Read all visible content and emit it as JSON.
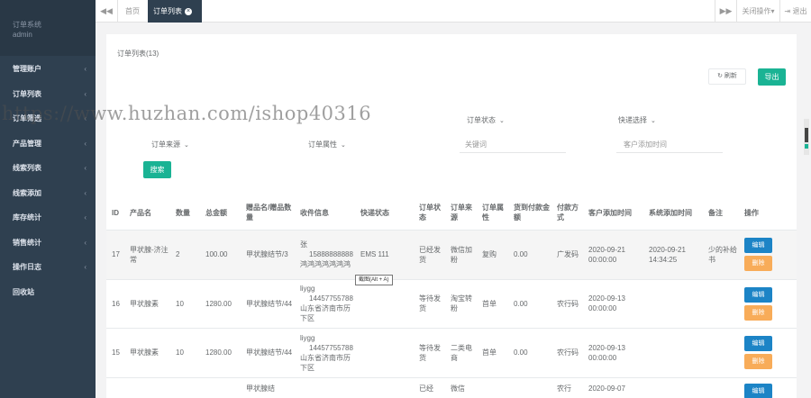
{
  "sidebar": {
    "app_name": "订单系统",
    "user": "admin",
    "items": [
      {
        "label": "管理账户"
      },
      {
        "label": "订单列表"
      },
      {
        "label": "订单筛选"
      },
      {
        "label": "产品管理"
      },
      {
        "label": "线索列表"
      },
      {
        "label": "线索添加"
      },
      {
        "label": "库存统计"
      },
      {
        "label": "销售统计"
      },
      {
        "label": "操作日志"
      },
      {
        "label": "回收站"
      }
    ],
    "chevron": "‹"
  },
  "topbar": {
    "back_icon": "◀◀",
    "home_tab": "首页",
    "active_tab": "订单列表",
    "close_tab_icon": "×",
    "forward_icon": "▶▶",
    "close_ops": "关闭操作▾",
    "logout": "⇥ 退出"
  },
  "panel": {
    "title": "订单列表(13)",
    "refresh": "↻ 刷新",
    "export": "导出"
  },
  "filters": {
    "row1": [
      {
        "label": "订单状态",
        "type": "select"
      },
      {
        "label": "快递选择",
        "type": "select"
      }
    ],
    "row2": [
      {
        "label": "订单来源",
        "type": "select"
      },
      {
        "label": "订单属性",
        "type": "select"
      },
      {
        "label": "关键词",
        "type": "input"
      },
      {
        "label": "客户添加时间",
        "type": "input"
      }
    ],
    "chevron": "⌄",
    "search": "搜索"
  },
  "table": {
    "headers": [
      "ID",
      "产品名",
      "数量",
      "总金额",
      "赠品名/赠品数量",
      "收件信息",
      "快递状态",
      "订单状态",
      "订单来源",
      "订单属性",
      "货到付款金额",
      "付款方式",
      "客户添加时间",
      "系统添加时间",
      "备注",
      "操作"
    ],
    "rows": [
      {
        "id": "17",
        "product": "甲状腺-济注常",
        "qty": "2",
        "total": "100.00",
        "gift": "甲状腺结节/3",
        "receiver_name": "张",
        "receiver_phone": "15888888888",
        "receiver_addr": "鸿鸿鸿鸿鸿鸿鸿",
        "express": "EMS 111",
        "status": "已经发货",
        "source": "微信加粉",
        "attr": "复购",
        "cod": "0.00",
        "pay": "广发码",
        "cust_time": "2020-09-21 00:00:00",
        "sys_time": "2020-09-21 14:34:25",
        "note": "少的补给书"
      },
      {
        "id": "16",
        "product": "甲状腺素",
        "qty": "10",
        "total": "1280.00",
        "gift": "甲状腺结节/44",
        "receiver_name": "liygg",
        "receiver_phone": "14457755788",
        "receiver_addr": "山东省济南市历下区",
        "express": "",
        "status": "等待发货",
        "source": "淘宝转粉",
        "attr": "首单",
        "cod": "0.00",
        "pay": "农行码",
        "cust_time": "2020-09-13 00:00:00",
        "sys_time": "",
        "note": ""
      },
      {
        "id": "15",
        "product": "甲状腺素",
        "qty": "10",
        "total": "1280.00",
        "gift": "甲状腺结节/44",
        "receiver_name": "liygg",
        "receiver_phone": "14457755788",
        "receiver_addr": "山东省济南市历下区",
        "express": "",
        "status": "等待发货",
        "source": "二类电商",
        "attr": "首单",
        "cod": "0.00",
        "pay": "农行码",
        "cust_time": "2020-09-13 00:00:00",
        "sys_time": "",
        "note": ""
      },
      {
        "id": "",
        "product": "",
        "qty": "",
        "total": "",
        "gift": "甲状腺结",
        "receiver_name": "",
        "receiver_phone": "",
        "receiver_addr": "",
        "express": "",
        "status": "已经",
        "source": "微信",
        "attr": "",
        "cod": "",
        "pay": "农行",
        "cust_time": "2020-09-07",
        "sys_time": "",
        "note": ""
      }
    ],
    "edit": "编辑",
    "delete": "删除"
  },
  "tooltip": "截图(Alt + A)",
  "watermark": "https://www.huzhan.com/ishop40316"
}
